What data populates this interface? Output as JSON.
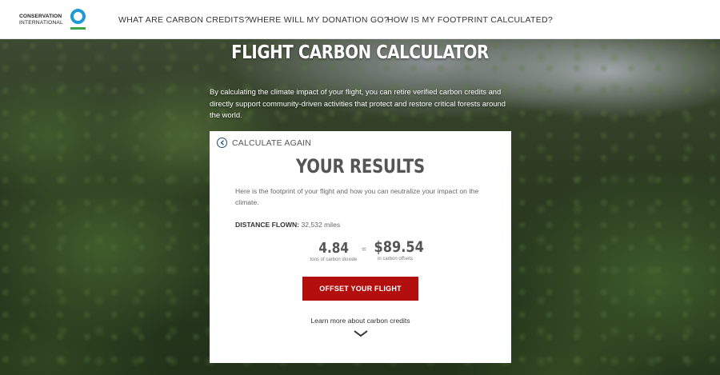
{
  "brand": {
    "line1": "CONSERVATION",
    "line2": "INTERNATIONAL",
    "colors": {
      "ring": "#1f9ad6",
      "bar": "#3aa845"
    }
  },
  "nav": [
    {
      "label": "WHAT ARE CARBON CREDITS?"
    },
    {
      "label": "WHERE WILL MY DONATION GO?"
    },
    {
      "label": "HOW IS MY FOOTPRINT CALCULATED?"
    }
  ],
  "hero": {
    "title": "FLIGHT CARBON CALCULATOR",
    "description": "By calculating the climate impact of your flight, you can retire verified carbon credits and directly support community-driven activities that protect and restore critical forests around the world."
  },
  "card": {
    "back_label": "CALCULATE AGAIN",
    "title": "YOUR RESULTS",
    "description": "Here is the footprint of your flight and how you can neutralize your impact on the climate.",
    "distance_label": "DISTANCE FLOWN:",
    "distance_value": "32,532 miles",
    "co2_value": "4.84",
    "co2_unit": "tons of carbon dioxide",
    "equals": "=",
    "offset_value": "$89.54",
    "offset_unit": "in carbon offsets",
    "cta_label": "OFFSET YOUR FLIGHT",
    "cta_color": "#b30f0f",
    "learn_more": "Learn more about carbon credits"
  }
}
